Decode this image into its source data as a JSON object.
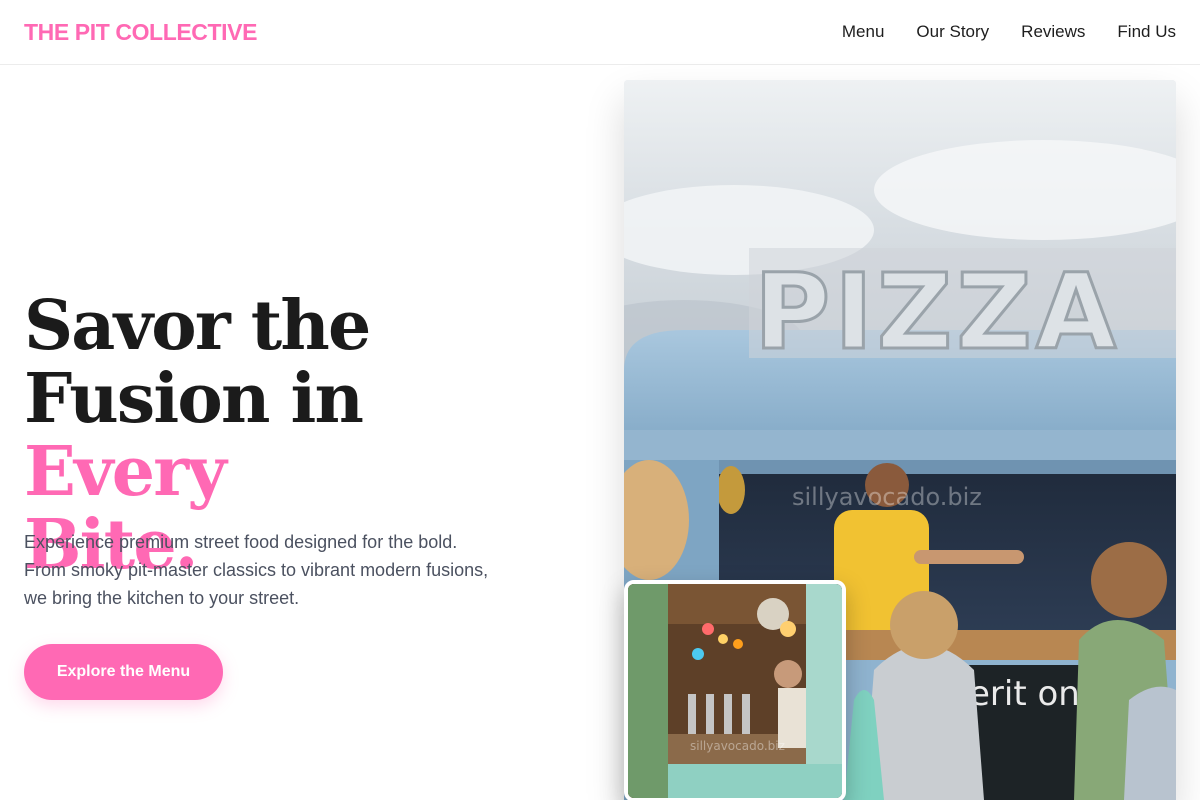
{
  "header": {
    "brand": "THE PIT COLLECTIVE",
    "nav": [
      "Menu",
      "Our Story",
      "Reviews",
      "Find Us"
    ]
  },
  "hero": {
    "headline_line1": "Savor the",
    "headline_line2": "Fusion in ",
    "headline_accent": "Every",
    "headline_line3": "Bite.",
    "description_lines": [
      "Experience premium street food designed for the bold.",
      "From smoky pit-master classics to vibrant modern fusions,",
      "we bring the kitchen to your street."
    ],
    "cta_label": "Explore the Menu",
    "main_photo": {
      "sign_text": "PIZZA",
      "watermark": "sillyavocado.biz",
      "chalkboard_text": "erit onil e -"
    },
    "inset_photo": {
      "watermark": "sillyavocado.biz"
    }
  },
  "colors": {
    "accent": "#ff69b4",
    "text": "#1b1b1b",
    "muted": "#4b5160",
    "truck_blue": "#8fb3cf"
  }
}
